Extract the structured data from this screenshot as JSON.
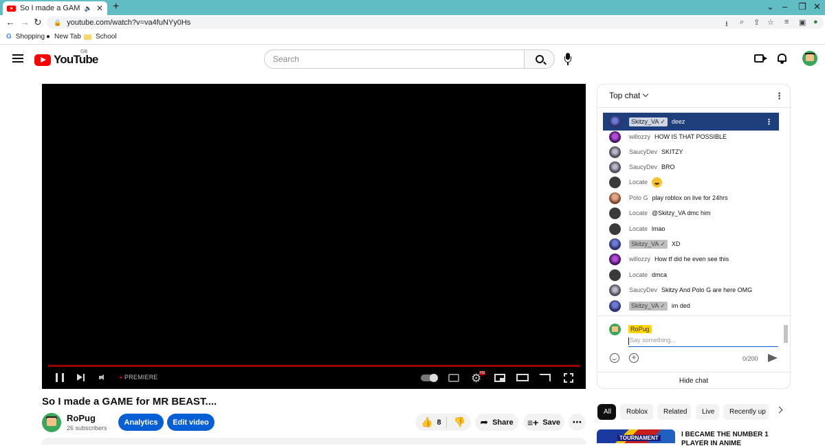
{
  "browser": {
    "tab_title": "So I made a GAME for MR BEAST",
    "url": "youtube.com/watch?v=va4fuNYy0Hs",
    "bookmarks": [
      "Shopping",
      "New Tab",
      "School"
    ]
  },
  "header": {
    "logo_text": "YouTube",
    "region": "GB",
    "search_placeholder": "Search"
  },
  "player": {
    "status_label": "PREMIERE",
    "hd_badge": "HD"
  },
  "video": {
    "title": "So I made a GAME for MR BEAST....",
    "channel_name": "RoPug",
    "subscribers": "26 subscribers",
    "analytics_label": "Analytics",
    "edit_label": "Edit video",
    "like_count": "8",
    "share_label": "Share",
    "save_label": "Save"
  },
  "chat": {
    "mode_label": "Top chat",
    "messages": [
      {
        "author": "Skitzy_VA ✓",
        "text": "deez",
        "verified": true,
        "highlighted": true
      },
      {
        "author": "willozzy",
        "text": "HOW IS THAT POSSIBLE"
      },
      {
        "author": "SaucyDev",
        "text": "SKITZY"
      },
      {
        "author": "SaucyDev",
        "text": "BRO"
      },
      {
        "author": "Locate",
        "text": "",
        "emoji": "laughing"
      },
      {
        "author": "Polo G",
        "text": "play roblox on live for 24hrs"
      },
      {
        "author": "Locate",
        "text": "@Skitzy_VA dmc him"
      },
      {
        "author": "Locate",
        "text": "lmao"
      },
      {
        "author": "Skitzy_VA ✓",
        "text": "XD",
        "verified": true
      },
      {
        "author": "willozzy",
        "text": "How tf did he even see this"
      },
      {
        "author": "Locate",
        "text": "dmca"
      },
      {
        "author": "SaucyDev",
        "text": "Skitzy And Polo G are here OMG"
      },
      {
        "author": "Skitzy_VA ✓",
        "text": "im ded",
        "verified": true
      }
    ],
    "composer_name": "RoPug",
    "input_placeholder": "Say something...",
    "char_count": "0/200",
    "hide_label": "Hide chat"
  },
  "filters": [
    "All",
    "Roblox",
    "Related",
    "Live",
    "Recently up"
  ],
  "related": {
    "thumb_tag": "TOURNAMENT",
    "title": "I BECAME THE NUMBER 1 PLAYER IN ANIME"
  }
}
